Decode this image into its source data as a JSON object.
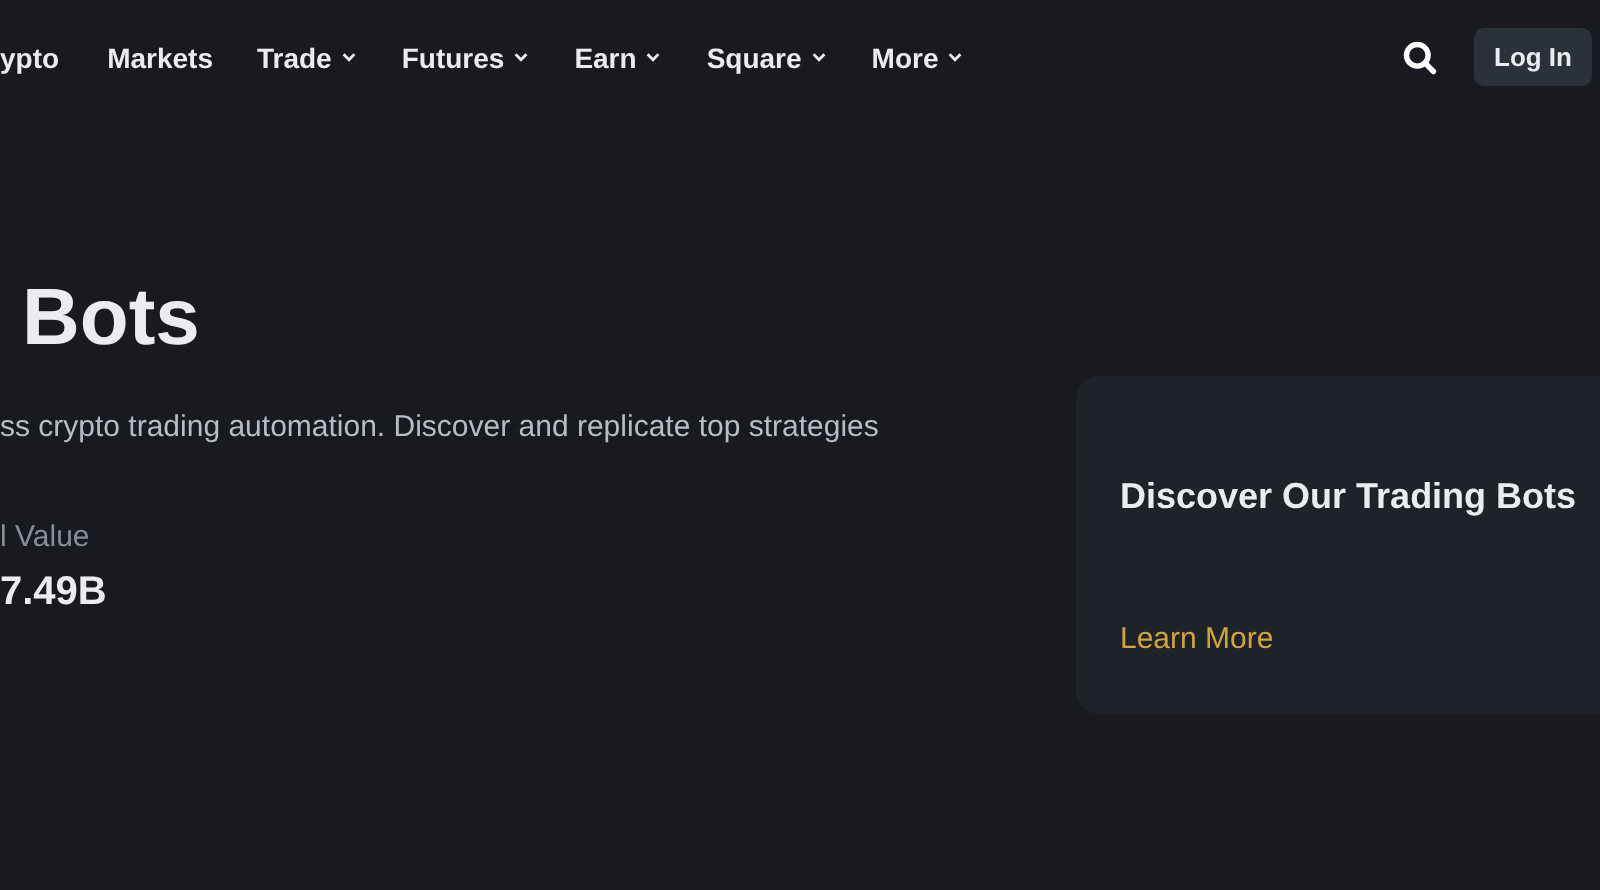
{
  "nav": {
    "items": [
      {
        "label": "ypto",
        "has_menu": false
      },
      {
        "label": "Markets",
        "has_menu": false
      },
      {
        "label": "Trade",
        "has_menu": true
      },
      {
        "label": "Futures",
        "has_menu": true
      },
      {
        "label": "Earn",
        "has_menu": true
      },
      {
        "label": "Square",
        "has_menu": true
      },
      {
        "label": "More",
        "has_menu": true
      }
    ],
    "login": "Log In"
  },
  "hero": {
    "title": "Bots",
    "description": "ss crypto trading automation. Discover and replicate top strategies",
    "stat_label": "l Value",
    "stat_value": "7.49B"
  },
  "card": {
    "title": "Discover Our Trading Bots",
    "link": "Learn More"
  }
}
